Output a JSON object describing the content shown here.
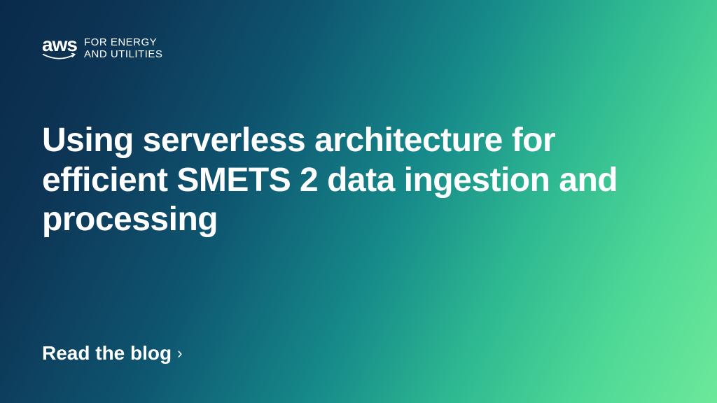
{
  "logo": {
    "brand": "aws",
    "subtitle_line1": "FOR ENERGY",
    "subtitle_line2": "AND UTILITIES"
  },
  "headline": "Using serverless architecture for efficient SMETS 2 data ingestion and processing",
  "cta": {
    "label": "Read the blog",
    "chevron": "›"
  }
}
